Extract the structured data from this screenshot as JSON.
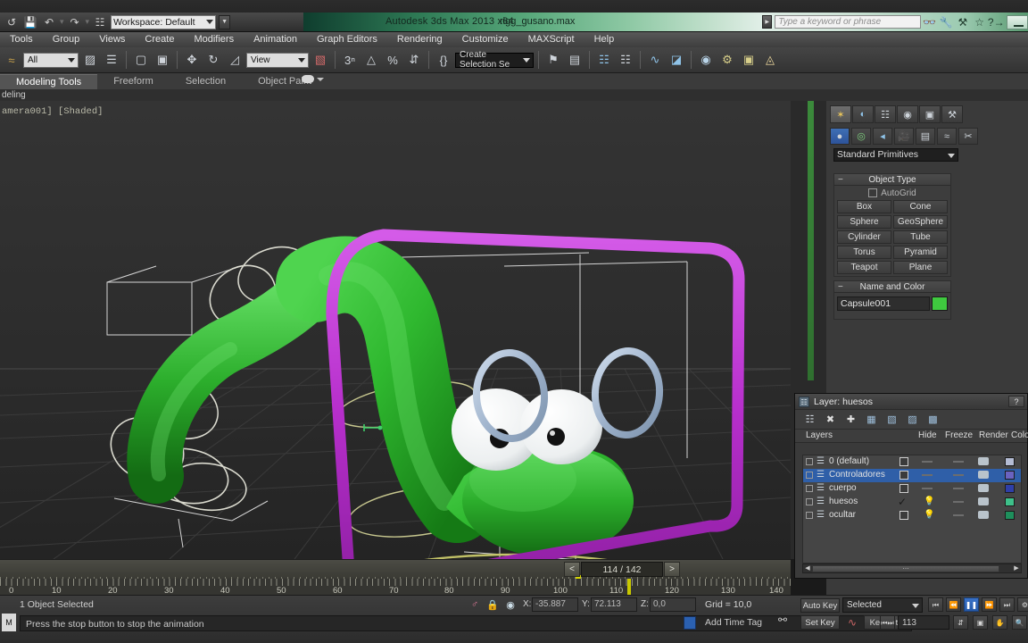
{
  "app": {
    "title": "Autodesk 3ds Max  2013 x64",
    "file": "rigg_gusano.max",
    "workspace": "Workspace: Default"
  },
  "search": {
    "placeholder": "Type a keyword or phrase"
  },
  "quick_access": {
    "icons": [
      "new-icon",
      "save-icon",
      "undo-icon",
      "redo-icon",
      "project-folder-icon"
    ]
  },
  "title_icons": [
    "binoculars-icon",
    "wrench-icon",
    "subscription-icon",
    "favorites-star-icon",
    "help-icon"
  ],
  "menu": {
    "items": [
      "Tools",
      "Group",
      "Views",
      "Create",
      "Modifiers",
      "Animation",
      "Graph Editors",
      "Rendering",
      "Customize",
      "MAXScript",
      "Help"
    ]
  },
  "toolbar": {
    "selection_filter": "All",
    "reference_coord": "View",
    "named_selection_set": "Create Selection Se",
    "icons": [
      "undo-view-icon",
      "select-object-icon",
      "select-by-name-icon",
      "rectangular-region-icon",
      "window-crossing-icon",
      "select-move-icon",
      "select-rotate-icon",
      "select-scale-icon",
      "snap-toggle-icon",
      "angle-snap-icon",
      "percent-snap-icon",
      "spinner-snap-icon",
      "edit-named-sets-icon",
      "mirror-icon",
      "align-icon",
      "layer-manager-icon",
      "curve-editor-icon",
      "schematic-view-icon",
      "material-editor-icon",
      "render-setup-icon",
      "render-frame-icon",
      "render-production-icon"
    ]
  },
  "ribbon": {
    "tabs": [
      "Modeling Tools",
      "Freeform",
      "Selection",
      "Object Paint"
    ],
    "active_tab": "Modeling Tools",
    "subtab": "deling"
  },
  "viewport": {
    "label": "amera001] [Shaded]"
  },
  "command_panel": {
    "tabs": [
      "create-tab",
      "modify-tab",
      "hierarchy-tab",
      "motion-tab",
      "display-tab",
      "utilities-tab"
    ],
    "active_tab_index": 0,
    "subtabs": [
      "geometry-icon",
      "shapes-icon",
      "lights-icon",
      "cameras-icon",
      "helpers-icon",
      "space-warps-icon",
      "systems-icon"
    ],
    "active_subtab_index": 0,
    "category": "Standard Primitives",
    "object_type": {
      "header": "Object Type",
      "autogrid_label": "AutoGrid",
      "buttons_left": [
        "Box",
        "Sphere",
        "Cylinder",
        "Torus",
        "Teapot"
      ],
      "buttons_right": [
        "Cone",
        "GeoSphere",
        "Tube",
        "Pyramid",
        "Plane"
      ]
    },
    "name_and_color": {
      "header": "Name and Color",
      "name": "Capsule001",
      "color": "#3fc93f"
    }
  },
  "layer_dialog": {
    "title": "Layer: huesos",
    "help_label": "?",
    "toolbar_icons": [
      "new-layer-icon",
      "delete-layer-icon",
      "add-layer-icon",
      "select-objects-icon",
      "select-highlighted-icon",
      "add-selection-icon",
      "hide-selection-icon"
    ],
    "columns": [
      "Layers",
      "Hide",
      "Freeze",
      "Render",
      "Color"
    ],
    "rows": [
      {
        "name": "0 (default)",
        "hide": "box",
        "freeze": "dash",
        "render": true,
        "color": "#b4bcd4",
        "selected": false
      },
      {
        "name": "Controladores",
        "hide": "box",
        "freeze": "dash",
        "render": true,
        "color": "#6a63c0",
        "selected": true
      },
      {
        "name": "cuerpo",
        "hide": "box",
        "freeze": "dash",
        "render": true,
        "color": "#2f3fa8",
        "selected": false
      },
      {
        "name": "huesos",
        "hide": "check",
        "freeze": "bulb",
        "render": true,
        "color": "#3ec08a",
        "selected": false
      },
      {
        "name": "ocultar",
        "hide": "box",
        "freeze": "bulb",
        "render": true,
        "color": "#1e8f5c",
        "selected": false
      }
    ]
  },
  "trackbar": {
    "frame_display": "114 / 142",
    "prev_label": "<",
    "next_label": ">"
  },
  "ruler": {
    "ticks": [
      "0",
      "10",
      "20",
      "30",
      "40",
      "50",
      "60",
      "70",
      "80",
      "90",
      "100",
      "110",
      "120",
      "130",
      "140"
    ]
  },
  "status": {
    "selection": "1 Object Selected",
    "prompt": "Press the stop button to stop the animation",
    "add_time_tag": "Add Time Tag",
    "coords": {
      "x_label": "X:",
      "x": "-35.887",
      "y_label": "Y:",
      "y": "72.113",
      "z_label": "Z:",
      "z": "0,0"
    },
    "grid": "Grid = 10,0",
    "icons": [
      "isolate-selection-icon",
      "selection-lock-icon",
      "absolute-mode-icon",
      "key-mode-icon"
    ]
  },
  "animation": {
    "auto_key": "Auto Key",
    "set_key": "Set Key",
    "key_mode": "Selected",
    "key_filters": "Key Filters...",
    "current_frame": "113",
    "playback_icons": [
      "go-to-start-icon",
      "previous-frame-icon",
      "play-pause-icon",
      "next-frame-icon",
      "go-to-end-icon"
    ],
    "playing": true
  },
  "colors": {
    "accent_purple": "#c03fd0",
    "worm_green": "#2aa82a",
    "ring_blue": "#9fb8d8",
    "ground_yellow": "#c9c96a",
    "selection_blue": "#2f5fa8"
  }
}
